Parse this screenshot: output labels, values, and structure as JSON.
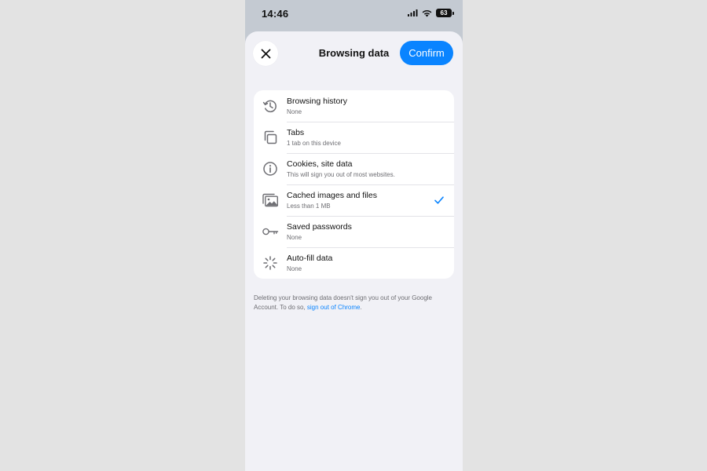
{
  "status_bar": {
    "time": "14:46",
    "battery": "63"
  },
  "header": {
    "title": "Browsing data",
    "confirm_label": "Confirm"
  },
  "items": [
    {
      "title": "Browsing history",
      "subtitle": "None",
      "icon": "history-icon",
      "checked": false
    },
    {
      "title": "Tabs",
      "subtitle": "1 tab on this device",
      "icon": "tabs-icon",
      "checked": false
    },
    {
      "title": "Cookies, site data",
      "subtitle": "This will sign you out of most websites.",
      "icon": "info-icon",
      "checked": false
    },
    {
      "title": "Cached images and files",
      "subtitle": "Less than 1 MB",
      "icon": "image-icon",
      "checked": true
    },
    {
      "title": "Saved passwords",
      "subtitle": "None",
      "icon": "key-icon",
      "checked": false
    },
    {
      "title": "Auto-fill data",
      "subtitle": "None",
      "icon": "autofill-icon",
      "checked": false
    }
  ],
  "footnote": {
    "text": "Deleting your browsing data doesn't sign you out of your Google Account. To do so, ",
    "link": "sign out of Chrome",
    "end": "."
  },
  "colors": {
    "accent": "#0a84ff",
    "sheet_background": "#f1f1f6",
    "page_background": "#e3e3e3"
  }
}
